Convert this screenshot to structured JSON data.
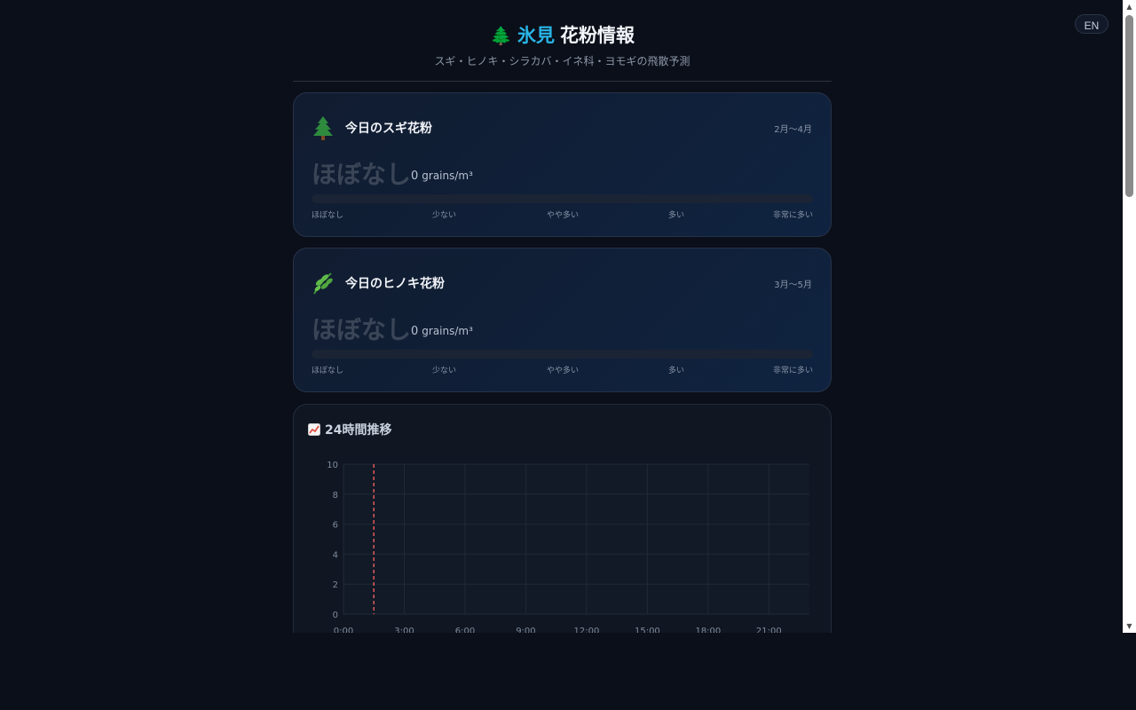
{
  "lang_toggle": "EN",
  "header": {
    "icon": "🌲",
    "city": "氷見",
    "title": "花粉情報",
    "subtitle": "スギ・ヒノキ・シラカバ・イネ科・ヨモギの飛散予測"
  },
  "cards": [
    {
      "icon": "evergreen-tree-icon",
      "title": "今日のスギ花粉",
      "season": "2月〜4月",
      "level_label": "ほぼなし",
      "value": "0",
      "unit": "grains/m³",
      "level_fraction": 0,
      "scale": [
        "ほぼなし",
        "少ない",
        "やや多い",
        "多い",
        "非常に多い"
      ]
    },
    {
      "icon": "herb-leaf-icon",
      "title": "今日のヒノキ花粉",
      "season": "3月〜5月",
      "level_label": "ほぼなし",
      "value": "0",
      "unit": "grains/m³",
      "level_fraction": 0,
      "scale": [
        "ほぼなし",
        "少ない",
        "やや多い",
        "多い",
        "非常に多い"
      ]
    }
  ],
  "chart": {
    "title": "24時間推移",
    "icon": "chart-increasing-icon",
    "now_line_color": "#e05a5a"
  },
  "chart_data": {
    "type": "line",
    "title": "24時間推移",
    "xlabel": "",
    "ylabel": "",
    "x_ticks": [
      "0:00",
      "3:00",
      "6:00",
      "9:00",
      "12:00",
      "15:00",
      "18:00",
      "21:00"
    ],
    "y_ticks": [
      0,
      2,
      4,
      6,
      8,
      10
    ],
    "ylim": [
      0,
      10
    ],
    "xlim_hours": [
      0,
      23
    ],
    "current_time_marker_hour": 1.5,
    "grid": true,
    "series": []
  }
}
